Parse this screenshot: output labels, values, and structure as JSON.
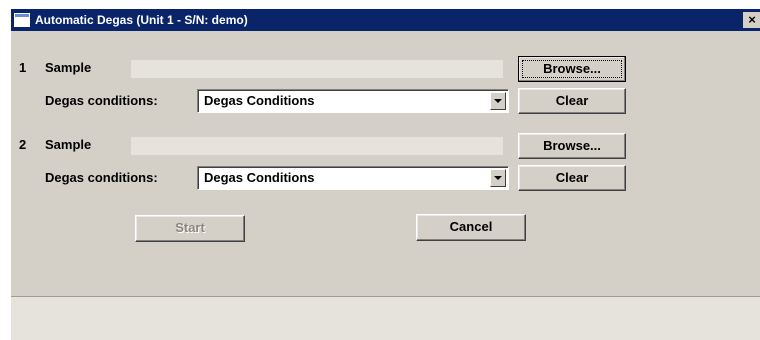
{
  "window": {
    "title": "Automatic Degas (Unit 1 - S/N: demo)",
    "close_glyph": "×"
  },
  "samples": [
    {
      "index": "1",
      "sample_label": "Sample",
      "sample_value": "",
      "browse_label": "Browse...",
      "conditions_label": "Degas conditions:",
      "conditions_value": "Degas Conditions",
      "clear_label": "Clear"
    },
    {
      "index": "2",
      "sample_label": "Sample",
      "sample_value": "",
      "browse_label": "Browse...",
      "conditions_label": "Degas conditions:",
      "conditions_value": "Degas Conditions",
      "clear_label": "Clear"
    }
  ],
  "actions": {
    "start_label": "Start",
    "cancel_label": "Cancel"
  },
  "status": {
    "text": ""
  }
}
